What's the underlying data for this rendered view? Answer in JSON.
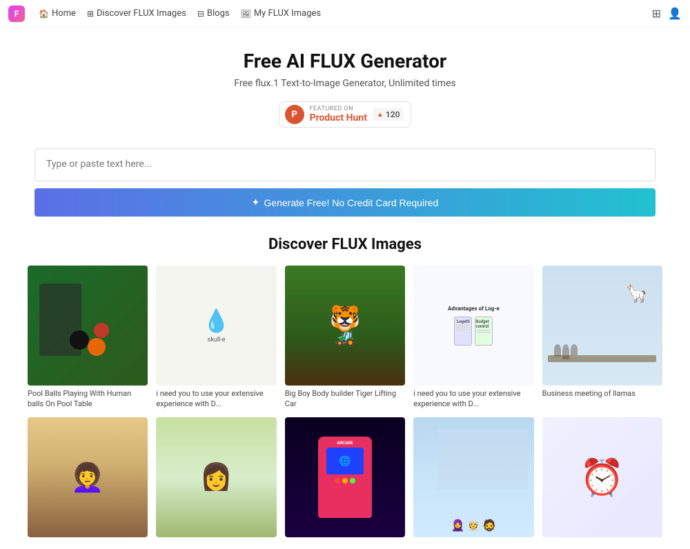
{
  "nav": {
    "logo_text": "F",
    "items": [
      {
        "id": "home",
        "label": "Home",
        "icon": "🏠"
      },
      {
        "id": "discover",
        "label": "Discover FLUX Images",
        "icon": "⊞"
      },
      {
        "id": "blogs",
        "label": "Blogs",
        "icon": "⊟"
      },
      {
        "id": "my-images",
        "label": "My FLUX Images",
        "icon": "🖼"
      }
    ]
  },
  "hero": {
    "title": "Free AI FLUX Generator",
    "subtitle": "Free flux.1 Text-to-Image Generator, Unlimited times"
  },
  "product_hunt": {
    "featured_label": "FEATURED ON",
    "name": "Product Hunt",
    "upvote_count": "120"
  },
  "input": {
    "placeholder": "Type or paste text here...",
    "button_label": "Generate Free! No Credit Card Required"
  },
  "discover": {
    "title": "Discover FLUX Images",
    "row1": [
      {
        "id": "billiards",
        "caption": "Pool Balls Playing With Human balls On Pool Table"
      },
      {
        "id": "droplet",
        "caption": "i need you to use your extensive experience with D..."
      },
      {
        "id": "tiger",
        "caption": "Big Boy Body builder Tiger Lifting Car"
      },
      {
        "id": "logoe",
        "caption": "i need you to use your extensive experience with D..."
      },
      {
        "id": "llama",
        "caption": "Business meeting of llamas"
      }
    ],
    "row2": [
      {
        "id": "anime1",
        "caption": ""
      },
      {
        "id": "anime2",
        "caption": ""
      },
      {
        "id": "arcade",
        "caption": ""
      },
      {
        "id": "meeting",
        "caption": ""
      },
      {
        "id": "clock",
        "caption": ""
      }
    ]
  }
}
